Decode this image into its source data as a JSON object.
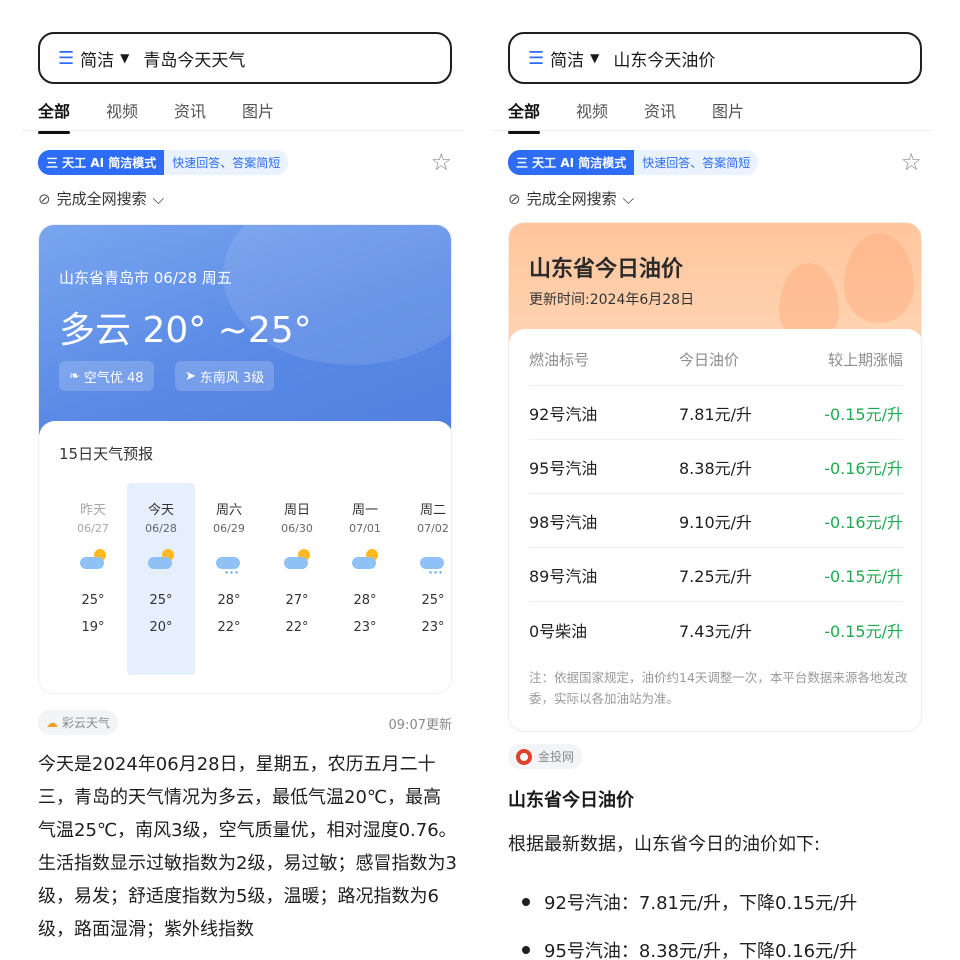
{
  "left": {
    "search": {
      "mode": "简洁",
      "query": "青岛今天天气"
    },
    "tabs": [
      "全部",
      "视频",
      "资讯",
      "图片"
    ],
    "ai": {
      "badge": "三 天工 AI 简洁模式",
      "desc": "快速回答、答案简短"
    },
    "complete": "完成全网搜索",
    "weather": {
      "location": "山东省青岛市 06/28 周五",
      "condition": "多云 20° ~25°",
      "air": "空气优 48",
      "wind": "东南风 3级",
      "forecast_title": "15日天气预报",
      "days": [
        {
          "day": "昨天",
          "date": "06/27",
          "hi": "25°",
          "lo": "19°",
          "icon": "partly-cloudy-icon"
        },
        {
          "day": "今天",
          "date": "06/28",
          "hi": "25°",
          "lo": "20°",
          "icon": "partly-cloudy-icon"
        },
        {
          "day": "周六",
          "date": "06/29",
          "hi": "28°",
          "lo": "22°",
          "icon": "rain-icon"
        },
        {
          "day": "周日",
          "date": "06/30",
          "hi": "27°",
          "lo": "22°",
          "icon": "partly-cloudy-icon"
        },
        {
          "day": "周一",
          "date": "07/01",
          "hi": "28°",
          "lo": "23°",
          "icon": "partly-cloudy-icon"
        },
        {
          "day": "周二",
          "date": "07/02",
          "hi": "25°",
          "lo": "23°",
          "icon": "rain-icon"
        }
      ]
    },
    "source": "彩云天气",
    "source_time": "09:07更新",
    "paragraph": "今天是2024年06月28日，星期五，农历五月二十三，青岛的天气情况为多云，最低气温20℃，最高气温25℃，南风3级，空气质量优，相对湿度0.76。生活指数显示过敏指数为2级，易过敏；感冒指数为3级，易发；舒适度指数为5级，温暖；路况指数为6级，路面湿滑；紫外线指数"
  },
  "right": {
    "search": {
      "mode": "简洁",
      "query": "山东今天油价"
    },
    "tabs": [
      "全部",
      "视频",
      "资讯",
      "图片"
    ],
    "ai": {
      "badge": "三 天工 AI 简洁模式",
      "desc": "快速回答、答案简短"
    },
    "complete": "完成全网搜索",
    "oil": {
      "title": "山东省今日油价",
      "update": "更新时间:2024年6月28日",
      "headers": [
        "燃油标号",
        "今日油价",
        "较上期涨幅"
      ],
      "rows": [
        {
          "name": "92号汽油",
          "price": "7.81元/升",
          "change": "-0.15元/升"
        },
        {
          "name": "95号汽油",
          "price": "8.38元/升",
          "change": "-0.16元/升"
        },
        {
          "name": "98号汽油",
          "price": "9.10元/升",
          "change": "-0.16元/升"
        },
        {
          "name": "89号汽油",
          "price": "7.25元/升",
          "change": "-0.15元/升"
        },
        {
          "name": "0号柴油",
          "price": "7.43元/升",
          "change": "-0.15元/升"
        }
      ],
      "note": "注：依据国家规定，油价约14天调整一次，本平台数据来源各地发改委，实际以各加油站为准。"
    },
    "source": "金投网",
    "heading": "山东省今日油价",
    "intro": "根据最新数据，山东省今日的油价如下:",
    "bullets": [
      "92号汽油：7.81元/升，下降0.15元/升",
      "95号汽油：8.38元/升，下降0.16元/升"
    ]
  },
  "colors": {
    "accent": "#2d6cf5",
    "drop": "#1faa51",
    "weather_bg": "#5a8ae6",
    "oil_bg": "#ffc69c"
  }
}
